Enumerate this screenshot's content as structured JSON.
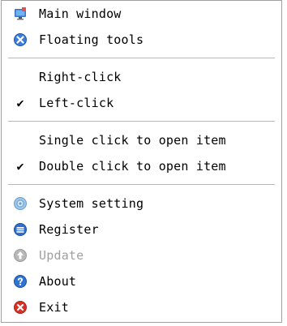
{
  "menu": {
    "group_view": [
      {
        "label": "Main window",
        "icon": "monitor-icon"
      },
      {
        "label": "Floating tools",
        "icon": "tools-icon"
      }
    ],
    "group_click": [
      {
        "label": "Right-click",
        "checked": false
      },
      {
        "label": "Left-click",
        "checked": true
      }
    ],
    "group_open": [
      {
        "label": "Single click to open item",
        "checked": false
      },
      {
        "label": "Double click to open item",
        "checked": true
      }
    ],
    "group_app": [
      {
        "label": "System setting",
        "icon": "settings-icon",
        "disabled": false
      },
      {
        "label": "Register",
        "icon": "register-icon",
        "disabled": false
      },
      {
        "label": "Update",
        "icon": "update-icon",
        "disabled": true
      },
      {
        "label": "About",
        "icon": "about-icon",
        "disabled": false
      },
      {
        "label": "Exit",
        "icon": "exit-icon",
        "disabled": false
      }
    ],
    "check_glyph": "✔"
  },
  "colors": {
    "accent_blue": "#2f74d0",
    "exit_red": "#d93025",
    "disabled_gray": "#a0a0a0"
  }
}
